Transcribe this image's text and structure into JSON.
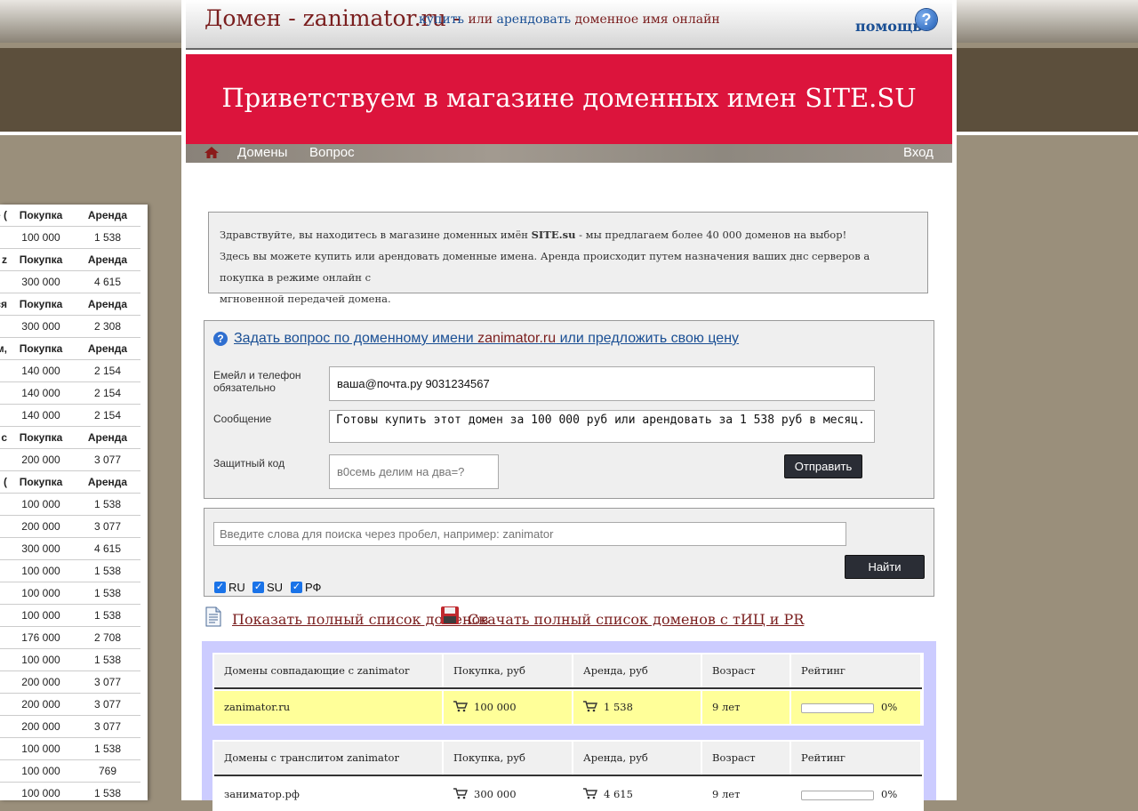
{
  "header": {
    "site_title": "Домен - zanimator.ru -",
    "tagline_buy": "купить",
    "tagline_or": " или ",
    "tagline_rent": "арендовать",
    "tagline_rest": " доменное имя онлайн",
    "help_label": "помощь",
    "help_icon_glyph": "?"
  },
  "banner": {
    "text": "Приветствуем в магазине доменных имен SITE.SU"
  },
  "nav": {
    "items": [
      {
        "label": "Домены"
      },
      {
        "label": "Вопрос"
      }
    ],
    "login": "Вход"
  },
  "intro": {
    "line1_before": "Здравствуйте, вы находитесь в магазине доменных имён ",
    "line1_bold": "SITE.su",
    "line1_after": " - мы предлагаем более 40 000 доменов на выбор!",
    "line2": "Здесь вы можете купить или арендовать доменные имена. Аренда происходит путем назначения ваших днс серверов а покупка в режиме онлайн с",
    "line3": "мгновенной передачей домена."
  },
  "question_form": {
    "title_before": "Задать вопрос по доменному имени ",
    "title_domain": "zanimator.ru",
    "title_after": " или предложить свою цену",
    "email_label": "Емейл и телефон обязательно",
    "email_value": "ваша@почта.ру 9031234567",
    "message_label": "Сообщение",
    "message_value": "Готовы купить этот домен за 100 000 руб или арендовать за 1 538 руб в месяц.",
    "captcha_label": "Защитный код",
    "captcha_placeholder": "в0семь делим на два=?",
    "submit_label": "Отправить"
  },
  "search": {
    "placeholder": "Введите слова для поиска через пробел, например: zanimator",
    "button_label": "Найти",
    "filters": [
      {
        "label": "RU",
        "checked": true
      },
      {
        "label": "SU",
        "checked": true
      },
      {
        "label": "РФ",
        "checked": true
      }
    ]
  },
  "links": {
    "show_all": "Показать полный список доменов",
    "download_all": "Скачать полный список доменов с тИЦ и PR"
  },
  "results": [
    {
      "headers": [
        "Домены совпадающие с zanimator",
        "Покупка, руб",
        "Аренда, руб",
        "Возраст",
        "Рейтинг"
      ],
      "rows": [
        {
          "domain": "zanimator.ru",
          "buy": "100 000",
          "rent": "1 538",
          "age": "9 лет",
          "rating": "0%",
          "rating_value": 0
        }
      ]
    },
    {
      "headers": [
        "Домены с транслитом zanimator",
        "Покупка, руб",
        "Аренда, руб",
        "Возраст",
        "Рейтинг"
      ],
      "rows": [
        {
          "domain": "заниматор.рф",
          "buy": "300 000",
          "rent": "4 615",
          "age": "9 лет",
          "rating": "0%",
          "rating_value": 0
        }
      ]
    }
  ],
  "sidebar": {
    "rows": [
      {
        "type": "header",
        "c1": "е (",
        "c2": "Покупка",
        "c3": "Аренда"
      },
      {
        "type": "data",
        "c1": "",
        "c2": "100 000",
        "c3": "1 538"
      },
      {
        "type": "header",
        "c1": "z",
        "c2": "Покупка",
        "c3": "Аренда"
      },
      {
        "type": "data",
        "c1": "",
        "c2": "300 000",
        "c3": "4 615"
      },
      {
        "type": "header",
        "c1": "ся",
        "c2": "Покупка",
        "c3": "Аренда"
      },
      {
        "type": "data",
        "c1": "",
        "c2": "300 000",
        "c3": "2 308"
      },
      {
        "type": "header",
        "c1": "м,",
        "c2": "Покупка",
        "c3": "Аренда"
      },
      {
        "type": "data",
        "c1": "",
        "c2": "140 000",
        "c3": "2 154"
      },
      {
        "type": "data",
        "c1": "",
        "c2": "140 000",
        "c3": "2 154"
      },
      {
        "type": "data",
        "c1": "",
        "c2": "140 000",
        "c3": "2 154"
      },
      {
        "type": "header",
        "c1": "с",
        "c2": "Покупка",
        "c3": "Аренда"
      },
      {
        "type": "data",
        "c1": "",
        "c2": "200 000",
        "c3": "3 077"
      },
      {
        "type": "header",
        "c1": ", (",
        "c2": "Покупка",
        "c3": "Аренда"
      },
      {
        "type": "data",
        "c1": "",
        "c2": "100 000",
        "c3": "1 538"
      },
      {
        "type": "data",
        "c1": "",
        "c2": "200 000",
        "c3": "3 077"
      },
      {
        "type": "data",
        "c1": "",
        "c2": "300 000",
        "c3": "4 615"
      },
      {
        "type": "data",
        "c1": "",
        "c2": "100 000",
        "c3": "1 538"
      },
      {
        "type": "data",
        "c1": "",
        "c2": "100 000",
        "c3": "1 538"
      },
      {
        "type": "data",
        "c1": "",
        "c2": "100 000",
        "c3": "1 538"
      },
      {
        "type": "data",
        "c1": "",
        "c2": "176 000",
        "c3": "2 708"
      },
      {
        "type": "data",
        "c1": "",
        "c2": "100 000",
        "c3": "1 538"
      },
      {
        "type": "data",
        "c1": "",
        "c2": "200 000",
        "c3": "3 077"
      },
      {
        "type": "data",
        "c1": "",
        "c2": "200 000",
        "c3": "3 077"
      },
      {
        "type": "data",
        "c1": "",
        "c2": "200 000",
        "c3": "3 077"
      },
      {
        "type": "data",
        "c1": "",
        "c2": "100 000",
        "c3": "1 538"
      },
      {
        "type": "data",
        "c1": "",
        "c2": "100 000",
        "c3": "769"
      },
      {
        "type": "data",
        "c1": "",
        "c2": "100 000",
        "c3": "1 538"
      }
    ]
  }
}
